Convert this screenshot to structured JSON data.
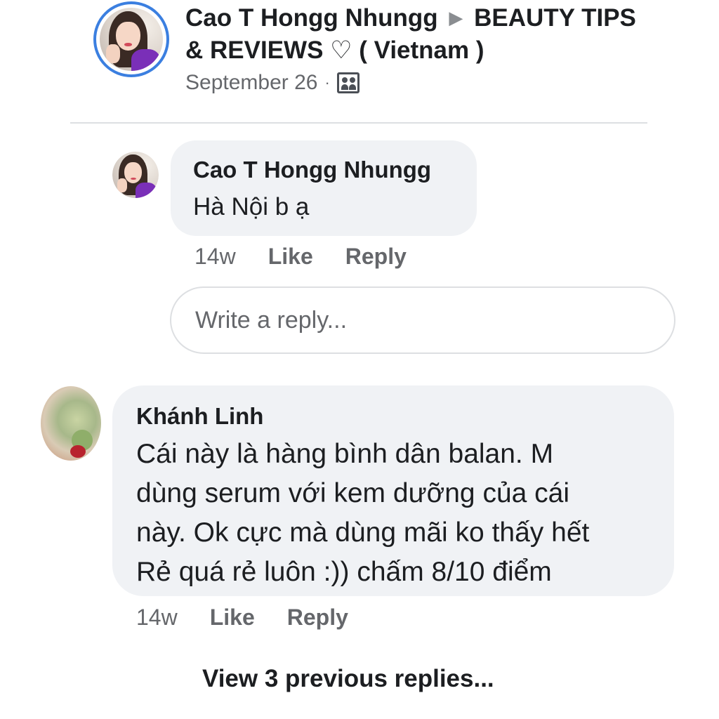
{
  "post": {
    "author": "Cao T Hongg Nhungg",
    "separator": "▶",
    "group": "BEAUTY TIPS & REVIEWS ♡ ( Vietnam )",
    "date": "September 26",
    "dot": "·",
    "privacy_icon": "group-icon"
  },
  "reply_comment": {
    "author": "Cao T Hongg Nhungg",
    "text": "Hà Nội b ạ",
    "time": "14w",
    "like_label": "Like",
    "reply_label": "Reply"
  },
  "reply_input": {
    "placeholder": "Write a reply..."
  },
  "main_comment": {
    "author": "Khánh Linh",
    "text": "Cái này là hàng bình dân balan. M\ndùng serum với kem dưỡng của cái\nnày. Ok cực mà dùng mãi ko thấy hết\nRẻ quá rẻ luôn :)) chấm 8/10 điểm",
    "time": "14w",
    "like_label": "Like",
    "reply_label": "Reply"
  },
  "view_replies": "View 3 previous replies...",
  "colors": {
    "avatar_ring": "#3b7fe0",
    "bubble": "#f0f2f5",
    "secondary_text": "#65676b",
    "primary_text": "#1c1e21"
  }
}
